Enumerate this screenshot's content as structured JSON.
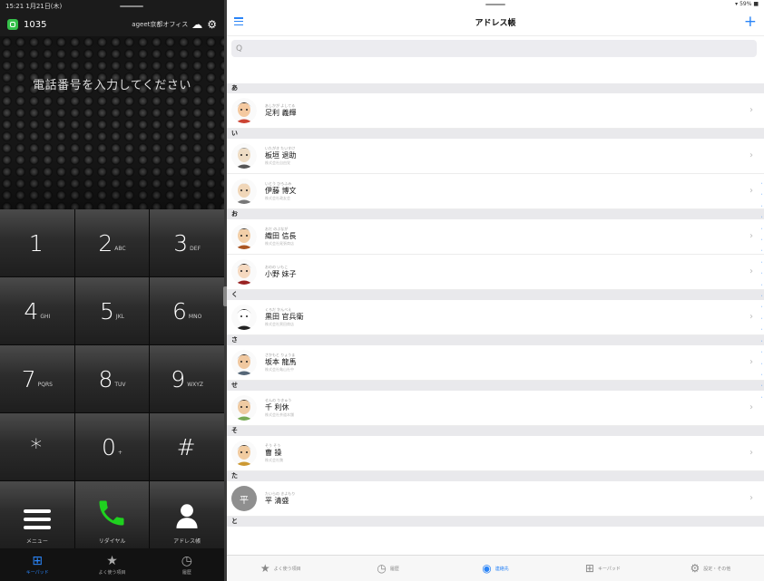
{
  "dialer": {
    "status_time": "15:21 1月21日(木)",
    "extension": "1035",
    "office": "ageet京都オフィス",
    "prompt": "電話番号を入力してください",
    "keys": [
      {
        "digit": "1",
        "letters": ""
      },
      {
        "digit": "2",
        "letters": "ABC"
      },
      {
        "digit": "3",
        "letters": "DEF"
      },
      {
        "digit": "4",
        "letters": "GHI"
      },
      {
        "digit": "5",
        "letters": "JKL"
      },
      {
        "digit": "6",
        "letters": "MNO"
      },
      {
        "digit": "7",
        "letters": "PQRS"
      },
      {
        "digit": "8",
        "letters": "TUV"
      },
      {
        "digit": "9",
        "letters": "WXYZ"
      },
      {
        "digit": "*",
        "letters": ""
      },
      {
        "digit": "0",
        "letters": "+"
      },
      {
        "digit": "#",
        "letters": ""
      }
    ],
    "menu_label": "メニュー",
    "redial_label": "リダイヤル",
    "addressbook_label": "アドレス帳",
    "tabs": [
      {
        "label": "キーパッド",
        "icon": "keypad-icon",
        "active": true
      },
      {
        "label": "よく使う項目",
        "icon": "star-icon",
        "active": false
      },
      {
        "label": "履歴",
        "icon": "clock-icon",
        "active": false
      }
    ]
  },
  "contacts": {
    "status_battery": "59%",
    "title": "アドレス帳",
    "add_label": "+",
    "search_placeholder": "Q",
    "sections": [
      {
        "header": "あ",
        "rows": [
          {
            "furigana": "あしかが よしてる",
            "name": "足利 義輝",
            "sub": ""
          }
        ]
      },
      {
        "header": "い",
        "rows": [
          {
            "furigana": "いたがき たいすけ",
            "name": "板垣 退助",
            "sub": "株式会社自由党"
          },
          {
            "furigana": "いとう ひろふみ",
            "name": "伊藤 博文",
            "sub": "株式会社政友会"
          }
        ]
      },
      {
        "header": "お",
        "rows": [
          {
            "furigana": "おだ のぶなが",
            "name": "織田 信長",
            "sub": "株式会社尾張商店"
          },
          {
            "furigana": "おのの いもこ",
            "name": "小野 妹子",
            "sub": ""
          }
        ]
      },
      {
        "header": "く",
        "rows": [
          {
            "furigana": "くろだ かんべえ",
            "name": "黒田 官兵衛",
            "sub": "株式会社黒田商店"
          }
        ]
      },
      {
        "header": "さ",
        "rows": [
          {
            "furigana": "さかもと りょうま",
            "name": "坂本 龍馬",
            "sub": "株式会社亀山社中"
          }
        ]
      },
      {
        "header": "せ",
        "rows": [
          {
            "furigana": "せんの りきゅう",
            "name": "千 利休",
            "sub": "株式会社茶道本舗"
          }
        ]
      },
      {
        "header": "そ",
        "rows": [
          {
            "furigana": "そう そう",
            "name": "曹 操",
            "sub": "株式会社魏"
          }
        ]
      },
      {
        "header": "た",
        "rows": [
          {
            "furigana": "たいらの きよもり",
            "name": "平 清盛",
            "sub": ""
          }
        ]
      },
      {
        "header": "と",
        "rows": []
      }
    ],
    "tabs": [
      {
        "label": "よく使う項目",
        "icon": "star-icon",
        "active": false
      },
      {
        "label": "履歴",
        "icon": "clock-icon",
        "active": false
      },
      {
        "label": "連絡先",
        "icon": "person-circle-icon",
        "active": true
      },
      {
        "label": "キーパッド",
        "icon": "keypad-icon",
        "active": false
      },
      {
        "label": "設定・その他",
        "icon": "gear-icon",
        "active": false
      }
    ]
  }
}
